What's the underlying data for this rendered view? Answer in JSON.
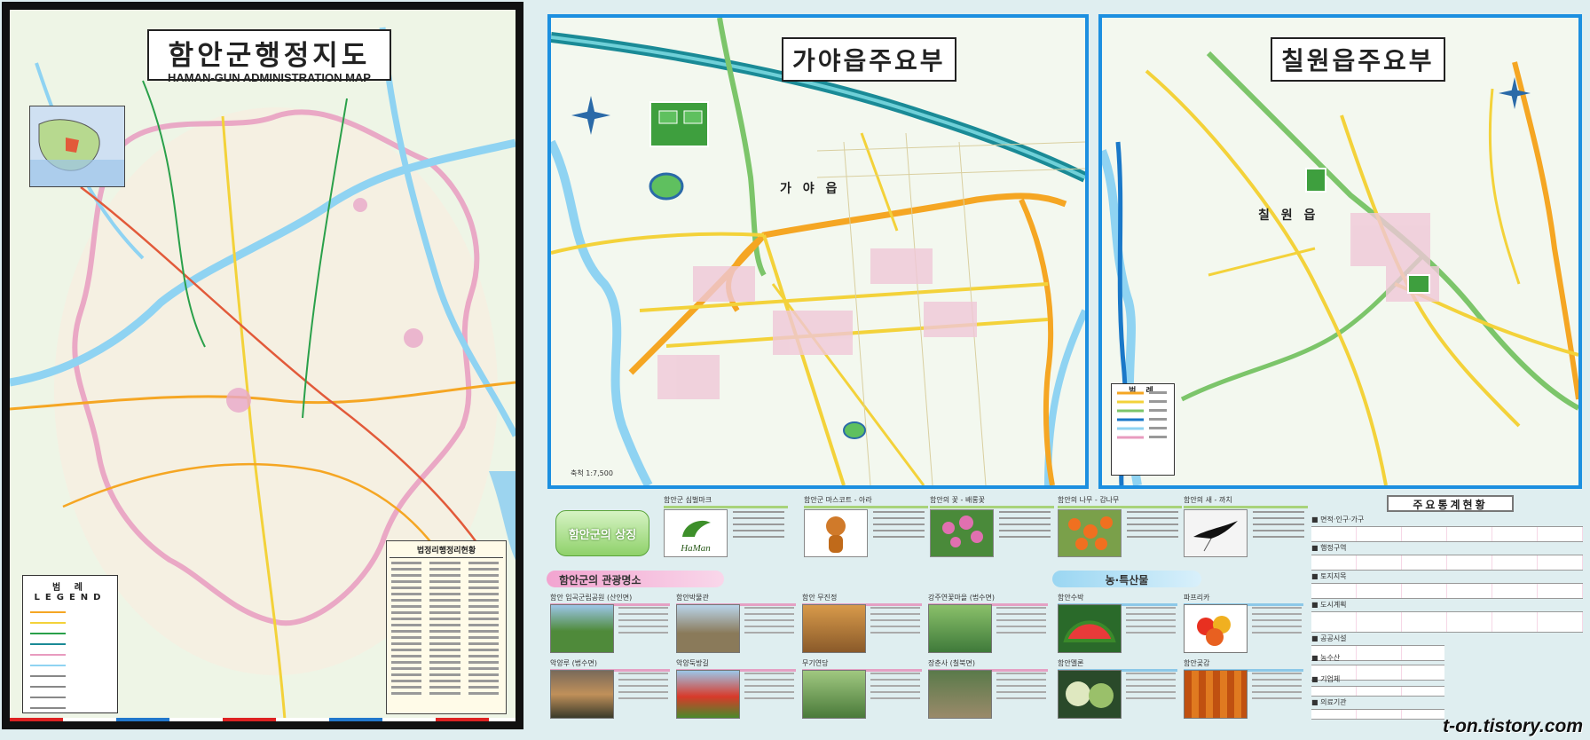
{
  "county_map": {
    "title_ko": "함안군행정지도",
    "title_en": "HAMAN-GUN ADMINISTRATION MAP",
    "legend_title": "범 례   LEGEND",
    "admin_table_title": "법정리행정리현황"
  },
  "gaya_map": {
    "title": "가야읍주요부",
    "town_label": "가 야 읍",
    "scale": "축척 1:7,500"
  },
  "chilwon_map": {
    "title": "칠원읍주요부",
    "town_label": "칠 원 읍",
    "legend_title": "범 례"
  },
  "symbols": {
    "header": "함안군의 상징",
    "items": [
      {
        "head": "함안군 심벌마크"
      },
      {
        "head": "함안군 마스코트 - 아라"
      },
      {
        "head": "함안의 꽃 - 배롱꽃"
      },
      {
        "head": "함안의 나무 - 감나무"
      },
      {
        "head": "함안의 새 - 까치"
      }
    ],
    "logo_text": "HaMan"
  },
  "tourism": {
    "header": "함안군의 관광명소",
    "spots": [
      {
        "head": "함안 입곡군립공원 (산인면)"
      },
      {
        "head": "함안박물관"
      },
      {
        "head": "함안 무진정"
      },
      {
        "head": "강주연꽃마을 (법수면)"
      },
      {
        "head": "악양루 (법수면)"
      },
      {
        "head": "악양둑방길"
      },
      {
        "head": "무기연당"
      },
      {
        "head": "장춘사 (칠북면)"
      }
    ]
  },
  "products": {
    "header": "농·특산물",
    "items": [
      {
        "head": "함안수박"
      },
      {
        "head": "파프리카"
      },
      {
        "head": "함안멜론"
      },
      {
        "head": "함안곶감"
      }
    ]
  },
  "stats": {
    "title": "주요통계현황",
    "blocks": [
      {
        "head": "■ 면적·인구·가구"
      },
      {
        "head": "■ 행정구역"
      },
      {
        "head": "■ 토지지목"
      },
      {
        "head": "■ 도시계획"
      },
      {
        "head": "■ 공공시설"
      },
      {
        "head": "■ 농수산"
      },
      {
        "head": "■ 기업체"
      },
      {
        "head": "■ 의료기관"
      }
    ]
  },
  "watermark": "t-on.tistory.com",
  "colors": {
    "frame_blue": "#1c8fe0",
    "road_orange": "#f5a623",
    "road_yellow": "#f3d23a",
    "highway_teal": "#1a8a96",
    "river": "#8fd3f2",
    "border_pink": "#e89bbf"
  }
}
